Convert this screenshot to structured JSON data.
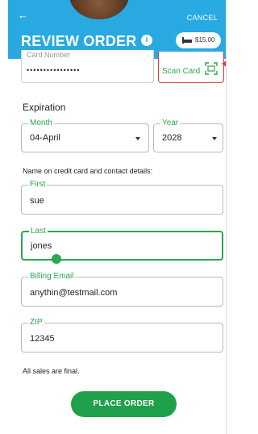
{
  "header": {
    "back_icon": "arrow-left-icon",
    "cancel_label": "CANCEL",
    "title": "REVIEW ORDER",
    "info_glyph": "i",
    "cart_icon": "cart-icon",
    "cart_total": "$15.00",
    "color": "#29a9e1"
  },
  "card": {
    "number_label": "Card Number",
    "number_value": "••••••••••••••••",
    "scan_label": "Scan Card",
    "scan_icon": "scan-card-icon"
  },
  "expiration": {
    "heading": "Expiration",
    "month_label": "Month",
    "month_value": "04-April",
    "year_label": "Year",
    "year_value": "2028"
  },
  "contact": {
    "heading": "Name on credit card and contact details:",
    "first_label": "First",
    "first_value": "sue",
    "last_label": "Last",
    "last_value": "jones",
    "email_label": "Billing Email",
    "email_value": "anythin@testmail.com",
    "zip_label": "ZIP",
    "zip_value": "12345"
  },
  "footer": {
    "final_note": "All sales are final.",
    "place_order_label": "PLACE ORDER",
    "accent": "#2aa84a"
  }
}
